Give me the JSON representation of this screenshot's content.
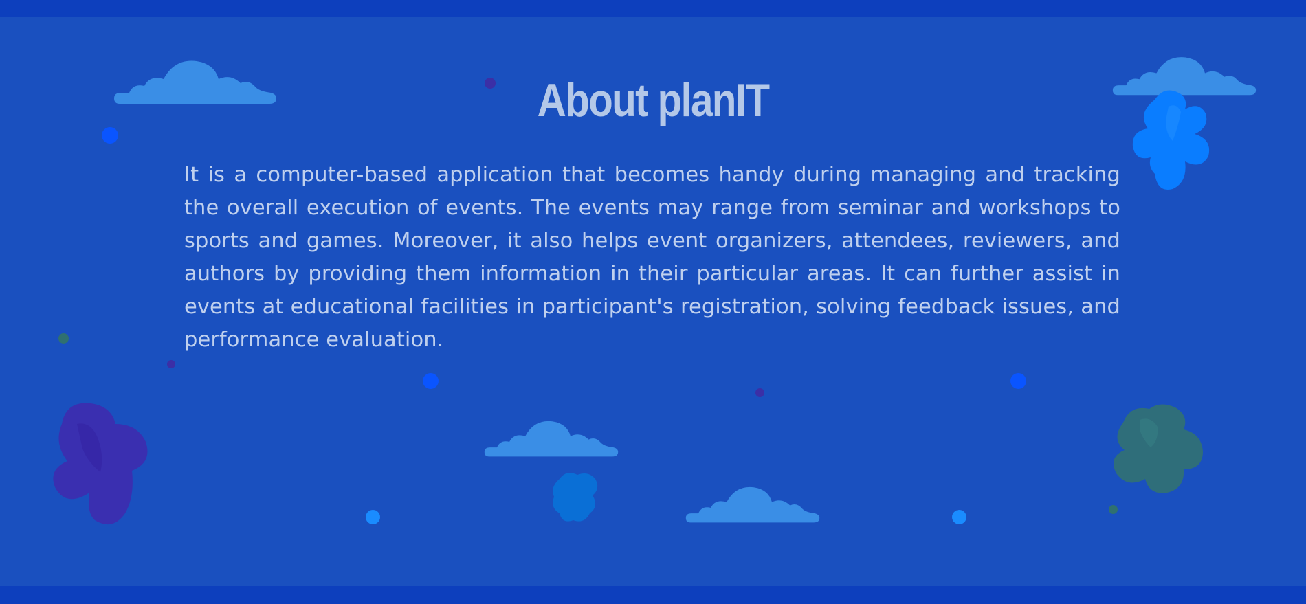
{
  "about": {
    "title": "About planIT",
    "description": "It is a computer-based application that becomes handy during managing and tracking the overall execution of events. The events may range from seminar and workshops to sports and games. Moreover, it also helps event organizers, attendees, reviewers, and authors by providing them information in their particular areas. It can further assist in events at educational facilities in participant's registration, solving feedback issues, and performance evaluation."
  },
  "colors": {
    "background": "#1a50bf",
    "band": "#0d3fbd",
    "title": "#b4c8e8",
    "text": "#bfd0ee",
    "cloud": "#3a8ee6",
    "blob_blue": "#0a7dff",
    "blob_purple": "#3a2fb0",
    "blob_teal": "#2f6e7a"
  },
  "decorations": [
    "cloud-icon",
    "blob-shape",
    "dot"
  ]
}
